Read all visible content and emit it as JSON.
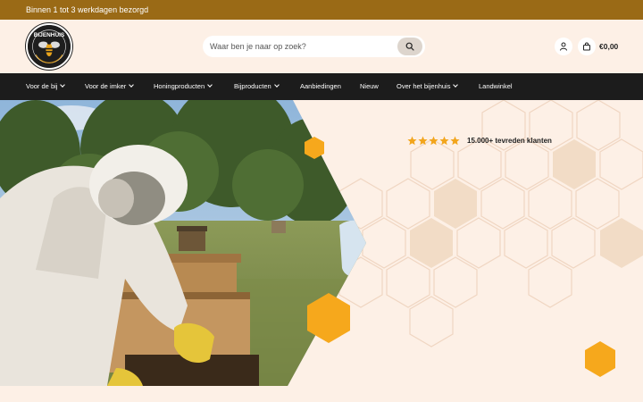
{
  "topbar": {
    "shipping_text": "Binnen 1 tot 3 werkdagen bezorgd"
  },
  "header": {
    "logo_name": "BIJENHUIS",
    "search": {
      "placeholder": "Waar ben je naar op zoek?"
    },
    "cart": {
      "amount": "€0,00"
    },
    "icons": {
      "account": "user-icon",
      "cart": "shopping-bag-icon",
      "search": "search-icon"
    }
  },
  "nav": {
    "items": [
      {
        "label": "Voor de bij",
        "has_dropdown": true
      },
      {
        "label": "Voor de imker",
        "has_dropdown": true
      },
      {
        "label": "Honingproducten",
        "has_dropdown": true
      },
      {
        "label": "Bijproducten",
        "has_dropdown": true
      },
      {
        "label": "Aanbiedingen",
        "has_dropdown": false
      },
      {
        "label": "Nieuw",
        "has_dropdown": false
      },
      {
        "label": "Over het bijenhuis",
        "has_dropdown": true
      },
      {
        "label": "Landwinkel",
        "has_dropdown": false
      }
    ]
  },
  "hero": {
    "rating": {
      "stars": 5,
      "text": "15.000+ tevreden klanten"
    }
  },
  "colors": {
    "topbar": "#9a6a16",
    "nav": "#1c1c1c",
    "background": "#fdf0e6",
    "honey": "#f6a81c",
    "star": "#f2a51c"
  }
}
